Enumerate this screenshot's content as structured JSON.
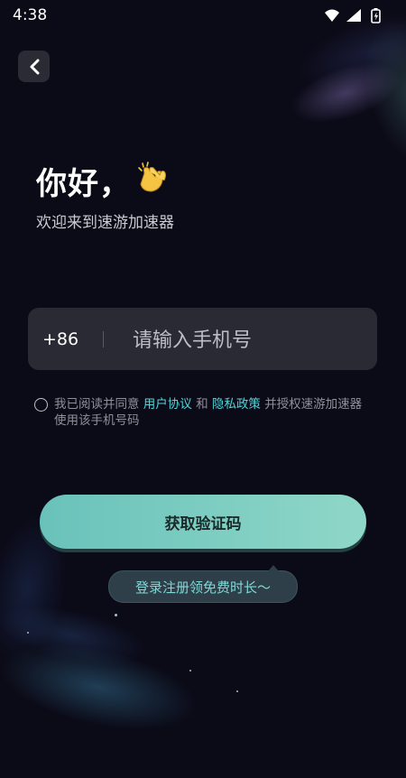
{
  "status_bar": {
    "time": "4:38"
  },
  "header": {
    "greeting": "你好，",
    "subtitle": "欢迎来到速游加速器"
  },
  "phone": {
    "country_code": "+86",
    "placeholder": "请输入手机号",
    "value": ""
  },
  "agreement": {
    "prefix": "我已阅读并同意",
    "user_agreement": "用户协议",
    "and": "和",
    "privacy_policy": "隐私政策",
    "suffix": "并授权速游加速器使用该手机号码",
    "checked": false
  },
  "actions": {
    "get_code_label": "获取验证码"
  },
  "promo": {
    "text": "登录注册领免费时长～"
  },
  "colors": {
    "background": "#0b0a17",
    "accent": "#54d4d8",
    "button_gradient_start": "#69c2ba",
    "button_gradient_end": "#8fd7c8"
  },
  "icons": {
    "back": "chevron-left-icon",
    "wave": "clapping-hands-icon",
    "wifi": "wifi-icon",
    "signal": "signal-icon",
    "battery": "battery-charging-icon"
  }
}
